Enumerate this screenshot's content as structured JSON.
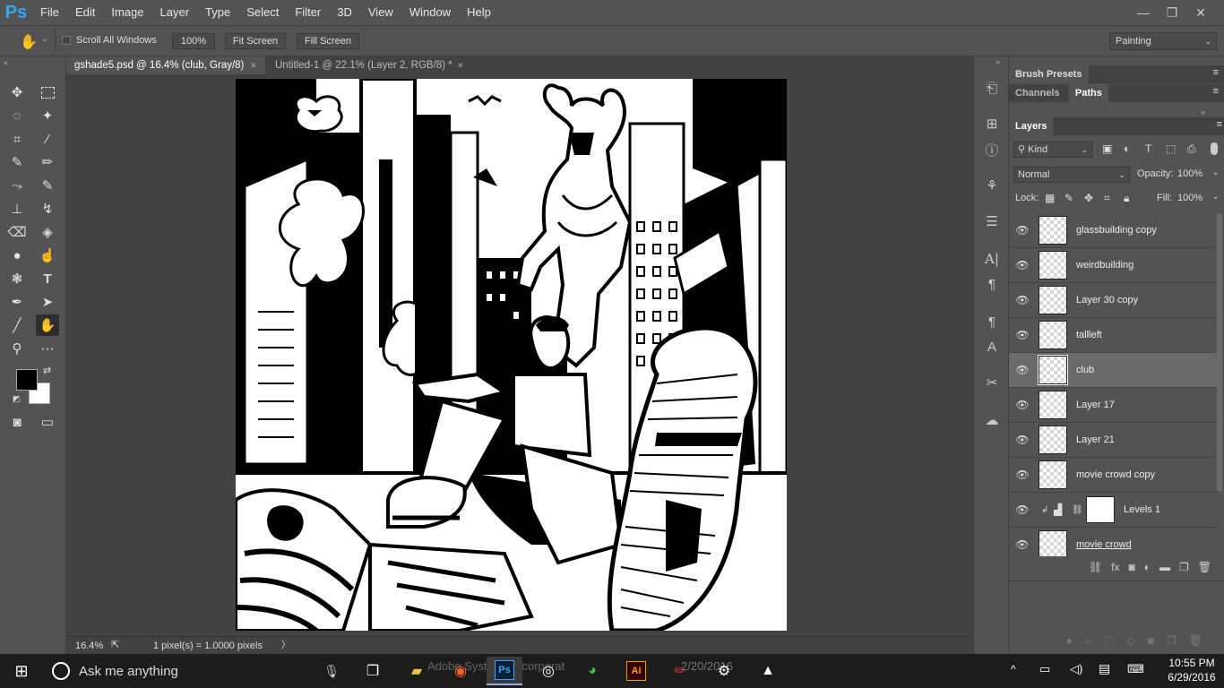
{
  "app": {
    "logo": "Ps"
  },
  "menu": [
    "File",
    "Edit",
    "Image",
    "Layer",
    "Type",
    "Select",
    "Filter",
    "3D",
    "View",
    "Window",
    "Help"
  ],
  "window_controls": {
    "minimize": "—",
    "restore": "❐",
    "close": "✕"
  },
  "options": {
    "hand_icon": "hand-icon",
    "scroll_all_windows": "Scroll All Windows",
    "zoom_100": "100%",
    "fit_screen": "Fit Screen",
    "fill_screen": "Fill Screen",
    "workspace": "Painting"
  },
  "tabs": [
    {
      "label": "gshade5.psd @ 16.4% (club, Gray/8)",
      "close": "✕",
      "active": true
    },
    {
      "label": "Untitled-1 @ 22.1% (Layer 2, RGB/8) *",
      "close": "✕",
      "active": false
    }
  ],
  "status": {
    "zoom": "16.4%",
    "info": "1 pixel(s) = 1.0000 pixels",
    "arrow": "〉"
  },
  "panels": {
    "brush_presets": "Brush Presets",
    "channels": "Channels",
    "paths": "Paths",
    "layers": "Layers",
    "kind": "Kind",
    "blend_mode": "Normal",
    "opacity_label": "Opacity:",
    "opacity_value": "100%",
    "lock_label": "Lock:",
    "fill_label": "Fill:",
    "fill_value": "100%"
  },
  "layers": [
    {
      "name": "glassbuilding copy"
    },
    {
      "name": "weirdbuilding"
    },
    {
      "name": "Layer 30 copy"
    },
    {
      "name": "tallleft"
    },
    {
      "name": "club",
      "selected": true
    },
    {
      "name": "Layer 17"
    },
    {
      "name": "Layer 21"
    },
    {
      "name": "movie crowd copy"
    },
    {
      "name": "Levels 1",
      "adjustment": true
    },
    {
      "name": "movie crowd"
    }
  ],
  "taskbar": {
    "search_placeholder": "Ask me anything",
    "time": "10:55 PM",
    "date": "6/29/2016",
    "partial_date": "2/20/2016",
    "adobe_text": "Adobe Systems Incorporat"
  }
}
